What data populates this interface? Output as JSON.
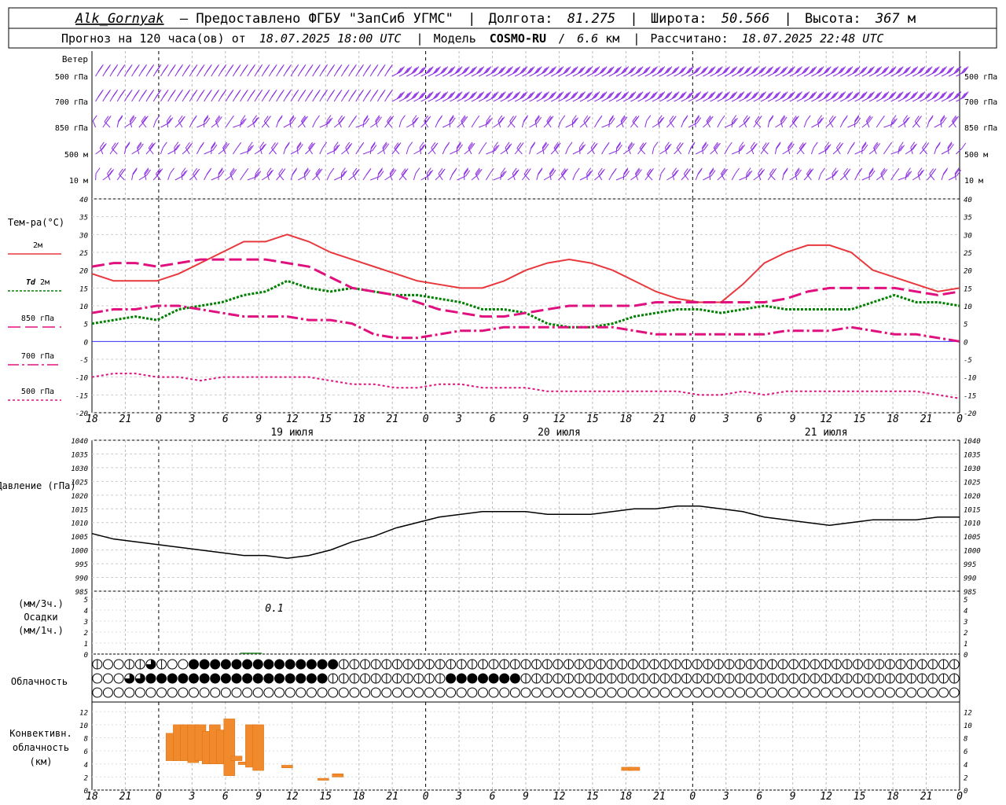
{
  "header": {
    "station": "Alk_Gornyak",
    "provider": "– Предоставлено ФГБУ \"ЗапСиб УГМС\"",
    "lon_label": "Долгота:",
    "lon_value": "81.275",
    "lat_label": "Широта:",
    "lat_value": "50.566",
    "alt_label": "Высота:",
    "alt_value": "367",
    "alt_unit": "м",
    "forecast_prefix": "Прогноз на 120 часа(ов) от",
    "forecast_start": "18.07.2025 18:00 UTC",
    "model_label": "Модель",
    "model_name": "COSMO-RU",
    "model_res": "6.6",
    "model_res_unit": "км",
    "computed_label": "Рассчитано:",
    "computed_at": "18.07.2025 22:48 UTC"
  },
  "wind": {
    "title": "Ветер",
    "levels": [
      "500 гПа",
      "700 гПа",
      "850 гПа",
      "500 м",
      "10  м"
    ],
    "color": "#8a2be2"
  },
  "time_axis": {
    "ticks": [
      "18",
      "21",
      "0",
      "3",
      "6",
      "9",
      "12",
      "15",
      "18",
      "21",
      "0",
      "3",
      "6",
      "9",
      "12",
      "15",
      "18",
      "21",
      "0",
      "3",
      "6",
      "9",
      "12",
      "15",
      "18",
      "21",
      "0"
    ],
    "days": [
      "19 июля",
      "20 июля",
      "21 июля"
    ]
  },
  "precip": {
    "label_lines": [
      "(мм/3ч.)",
      "Осадки",
      "(мм/1ч.)"
    ],
    "annotation": "0.1",
    "yticks": [
      "0",
      "1",
      "2",
      "3",
      "4",
      "5"
    ]
  },
  "clouds": {
    "label": "Облачность",
    "rows": [
      "iooii3iooooooooiiiioiiiiiiiiiiiiiiiiiiiiiiiiiiiiiiiiiiiiiiiiiiiiiiiiiiiiiiiiiiiiii",
      "ooo33iioiooooooooooooiiiiiiiiiiiiiiiiiiiiiiiiiiiiiiiiiiiiiiiiiiiiiiiiiiiiiiiiiiiiiiii",
      "ooooooooooooooooooooooooooooooooooooooooooooooooooooooooooooooooooooooooooooooooo"
    ]
  },
  "convective": {
    "label_lines": [
      "Конвективн.",
      "облачность",
      "(км)"
    ],
    "yticks": [
      "0",
      "2",
      "4",
      "6",
      "8",
      "10",
      "12"
    ]
  },
  "chart_data": [
    {
      "type": "line",
      "title": "",
      "ylabel": "Тем-ра(°C)",
      "ylim": [
        -20,
        40
      ],
      "yticks": [
        -20,
        -15,
        -10,
        -5,
        0,
        5,
        10,
        15,
        20,
        25,
        30,
        35,
        40
      ],
      "x_hours": [
        0,
        3,
        6,
        9,
        12,
        15,
        18,
        21,
        24,
        27,
        30,
        33,
        36,
        39,
        42,
        45,
        48,
        51,
        54,
        57,
        60,
        63,
        66,
        69,
        72,
        75,
        78,
        81,
        84,
        87,
        90,
        93,
        96,
        99,
        102,
        105,
        108,
        111,
        114,
        117,
        120
      ],
      "series": [
        {
          "name": "2м",
          "color": "#e8383d",
          "dash": "solid",
          "width": 2,
          "values": [
            19,
            17,
            17,
            17,
            19,
            22,
            25,
            28,
            28,
            30,
            28,
            25,
            23,
            21,
            19,
            17,
            16,
            15,
            15,
            17,
            20,
            22,
            23,
            22,
            20,
            17,
            14,
            12,
            11,
            11,
            16,
            22,
            25,
            27,
            27,
            25,
            20,
            18,
            16,
            14,
            15
          ]
        },
        {
          "name": "Td",
          "name_suffix": "2м",
          "color": "#008000",
          "dash": "3,2",
          "width": 3,
          "values": [
            5,
            6,
            7,
            6,
            9,
            10,
            11,
            13,
            14,
            17,
            15,
            14,
            15,
            14,
            13,
            13,
            12,
            11,
            9,
            9,
            8,
            5,
            4,
            4,
            5,
            7,
            8,
            9,
            9,
            8,
            9,
            10,
            9,
            9,
            9,
            9,
            11,
            13,
            11,
            11,
            10
          ]
        },
        {
          "name": "850 гПа",
          "color": "#e0107f",
          "dash": "16,6",
          "width": 3,
          "values": [
            21,
            22,
            22,
            21,
            22,
            23,
            23,
            23,
            23,
            22,
            21,
            18,
            15,
            14,
            13,
            11,
            9,
            8,
            7,
            7,
            8,
            9,
            10,
            10,
            10,
            10,
            11,
            11,
            11,
            11,
            11,
            11,
            12,
            14,
            15,
            15,
            15,
            15,
            14,
            13,
            14
          ]
        },
        {
          "name": "700 гПа",
          "color": "#e0107f",
          "dash": "14,4,3,4",
          "width": 3,
          "values": [
            8,
            9,
            9,
            10,
            10,
            9,
            8,
            7,
            7,
            7,
            6,
            6,
            5,
            2,
            1,
            1,
            2,
            3,
            3,
            4,
            4,
            4,
            4,
            4,
            4,
            3,
            2,
            2,
            2,
            2,
            2,
            2,
            3,
            3,
            3,
            4,
            3,
            2,
            2,
            1,
            0
          ]
        },
        {
          "name": "500 гПа",
          "color": "#e0107f",
          "dash": "3,3",
          "width": 2,
          "values": [
            -10,
            -9,
            -9,
            -10,
            -10,
            -11,
            -10,
            -10,
            -10,
            -10,
            -10,
            -11,
            -12,
            -12,
            -13,
            -13,
            -12,
            -12,
            -13,
            -13,
            -13,
            -14,
            -14,
            -14,
            -14,
            -14,
            -14,
            -14,
            -15,
            -15,
            -14,
            -15,
            -14,
            -14,
            -14,
            -14,
            -14,
            -14,
            -14,
            -15,
            -16
          ]
        }
      ]
    },
    {
      "type": "line",
      "title": "",
      "ylabel": "Давление (гПа)",
      "ylim": [
        985,
        1040
      ],
      "yticks": [
        985,
        990,
        995,
        1000,
        1005,
        1010,
        1015,
        1020,
        1025,
        1030,
        1035,
        1040
      ],
      "x_hours": [
        0,
        3,
        6,
        9,
        12,
        15,
        18,
        21,
        24,
        27,
        30,
        33,
        36,
        39,
        42,
        45,
        48,
        51,
        54,
        57,
        60,
        63,
        66,
        69,
        72,
        75,
        78,
        81,
        84,
        87,
        90,
        93,
        96,
        99,
        102,
        105,
        108,
        111,
        114,
        117,
        120
      ],
      "series": [
        {
          "name": "",
          "color": "#000000",
          "values": [
            1006,
            1004,
            1003,
            1002,
            1001,
            1000,
            999,
            998,
            998,
            997,
            998,
            1000,
            1003,
            1005,
            1008,
            1010,
            1012,
            1013,
            1014,
            1014,
            1014,
            1013,
            1013,
            1013,
            1014,
            1015,
            1015,
            1016,
            1016,
            1015,
            1014,
            1012,
            1011,
            1010,
            1009,
            1010,
            1011,
            1011,
            1011,
            1012,
            1012
          ]
        }
      ]
    },
    {
      "type": "bar",
      "title": "",
      "ylabel": "Конвективн. облачность (км)",
      "ylim": [
        0,
        13
      ],
      "bars": [
        {
          "hour": 11,
          "base": 4.5,
          "top": 8.7
        },
        {
          "hour": 12,
          "base": 4.5,
          "top": 10.0
        },
        {
          "hour": 13,
          "base": 4.5,
          "top": 10.0
        },
        {
          "hour": 14,
          "base": 4.2,
          "top": 10.0
        },
        {
          "hour": 15,
          "base": 4.5,
          "top": 10.0
        },
        {
          "hour": 16,
          "base": 4.0,
          "top": 9.0
        },
        {
          "hour": 17,
          "base": 4.0,
          "top": 10.0
        },
        {
          "hour": 18,
          "base": 4.0,
          "top": 9.2
        },
        {
          "hour": 19,
          "base": 2.2,
          "top": 10.9
        },
        {
          "hour": 20,
          "base": 4.5,
          "top": 5.2
        },
        {
          "hour": 21,
          "base": 3.9,
          "top": 4.3
        },
        {
          "hour": 22,
          "base": 3.5,
          "top": 10.0
        },
        {
          "hour": 23,
          "base": 3.0,
          "top": 10.0
        },
        {
          "hour": 27,
          "base": 3.4,
          "top": 3.8
        },
        {
          "hour": 32,
          "base": 1.5,
          "top": 1.8
        },
        {
          "hour": 34,
          "base": 2.0,
          "top": 2.5
        },
        {
          "hour": 74,
          "base": 3.0,
          "top": 3.5
        },
        {
          "hour": 75,
          "base": 3.0,
          "top": 3.5
        }
      ]
    }
  ]
}
